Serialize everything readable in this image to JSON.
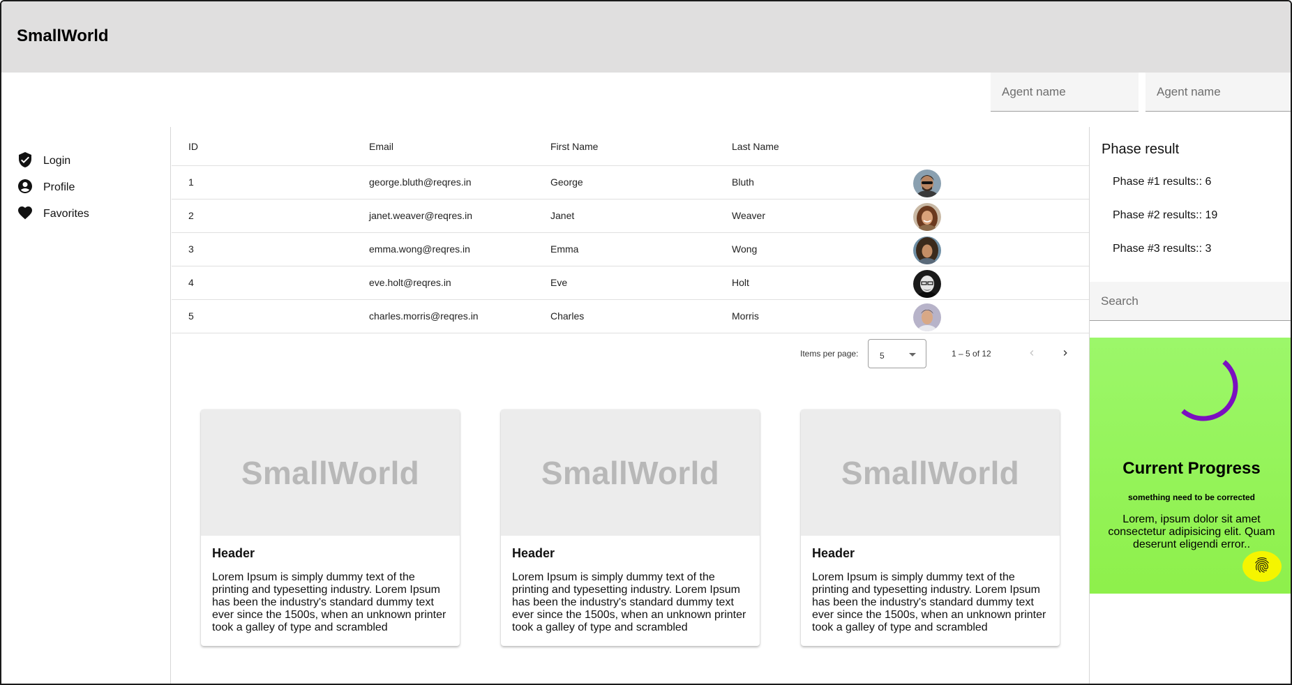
{
  "app": {
    "title": "SmallWorld"
  },
  "header": {
    "agent_fields": [
      {
        "placeholder": "Agent name"
      },
      {
        "placeholder": "Agent name"
      }
    ]
  },
  "sidebar": {
    "items": [
      {
        "label": "Login",
        "icon": "shield-check-icon"
      },
      {
        "label": "Profile",
        "icon": "account-circle-icon"
      },
      {
        "label": "Favorites",
        "icon": "heart-icon"
      }
    ]
  },
  "table": {
    "columns": [
      "ID",
      "Email",
      "First Name",
      "Last Name"
    ],
    "rows": [
      {
        "id": "1",
        "email": "george.bluth@reqres.in",
        "first": "George",
        "last": "Bluth",
        "avatar": "avatar-george"
      },
      {
        "id": "2",
        "email": "janet.weaver@reqres.in",
        "first": "Janet",
        "last": "Weaver",
        "avatar": "avatar-janet"
      },
      {
        "id": "3",
        "email": "emma.wong@reqres.in",
        "first": "Emma",
        "last": "Wong",
        "avatar": "avatar-emma"
      },
      {
        "id": "4",
        "email": "eve.holt@reqres.in",
        "first": "Eve",
        "last": "Holt",
        "avatar": "avatar-eve"
      },
      {
        "id": "5",
        "email": "charles.morris@reqres.in",
        "first": "Charles",
        "last": "Morris",
        "avatar": "avatar-charles"
      }
    ],
    "paginator": {
      "items_per_page_label": "Items per page:",
      "page_size": "5",
      "range": "1 – 5 of 12"
    }
  },
  "cards": [
    {
      "image_text": "SmallWorld",
      "header": "Header",
      "body": "Lorem Ipsum is simply dummy text of the printing and typesetting industry. Lorem Ipsum has been the industry's standard dummy text ever since the 1500s, when an unknown printer took a galley of type and scrambled"
    },
    {
      "image_text": "SmallWorld",
      "header": "Header",
      "body": "Lorem Ipsum is simply dummy text of the printing and typesetting industry. Lorem Ipsum has been the industry's standard dummy text ever since the 1500s, when an unknown printer took a galley of type and scrambled"
    },
    {
      "image_text": "SmallWorld",
      "header": "Header",
      "body": "Lorem Ipsum is simply dummy text of the printing and typesetting industry. Lorem Ipsum has been the industry's standard dummy text ever since the 1500s, when an unknown printer took a galley of type and scrambled"
    }
  ],
  "phase": {
    "title": "Phase result",
    "items": [
      "Phase #1 results:: 6",
      "Phase #2 results:: 19",
      "Phase #3 results:: 3"
    ]
  },
  "search": {
    "placeholder": "Search"
  },
  "progress": {
    "title": "Current Progress",
    "subtitle": "something need to be corrected",
    "body": "Lorem, ipsum dolor sit amet consectetur adipisicing elit. Quam deserunt eligendi error..",
    "fab_icon": "fingerprint-icon",
    "spinner_color": "#7b0fc0",
    "background_color": "#95f45c",
    "fab_color": "#f5f500"
  }
}
